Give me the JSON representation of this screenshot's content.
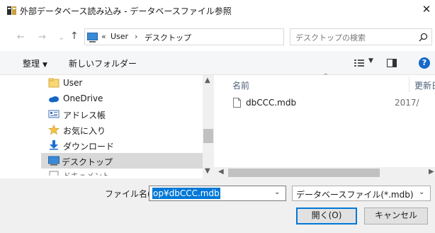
{
  "window": {
    "title": "外部データベース読み込み - データベースファイル参照",
    "close": "✕"
  },
  "address": {
    "back": "←",
    "forward": "→",
    "recent": "⌄",
    "up": "↑",
    "overflow": "«",
    "crumbs": [
      "User",
      "デスクトップ"
    ],
    "separator": "›",
    "dropdown": "⌄",
    "refresh": "↻"
  },
  "search": {
    "placeholder": "デスクトップの検索"
  },
  "toolbar": {
    "organize": "整理",
    "organize_caret": "▼",
    "new_folder": "新しいフォルダー",
    "view_caret": "▼",
    "help": "?"
  },
  "nav": {
    "items": [
      {
        "label": "User",
        "icon": "folder-icon"
      },
      {
        "label": "OneDrive",
        "icon": "onedrive-icon"
      },
      {
        "label": "アドレス帳",
        "icon": "address-book-icon"
      },
      {
        "label": "お気に入り",
        "icon": "favorites-star-icon"
      },
      {
        "label": "ダウンロード",
        "icon": "download-icon"
      },
      {
        "label": "デスクトップ",
        "icon": "desktop-icon",
        "selected": true
      },
      {
        "label": "ドキュメント",
        "icon": "documents-icon"
      }
    ]
  },
  "scroll": {
    "up": "▲",
    "down": "▼",
    "left": "◀",
    "right": "▶"
  },
  "files": {
    "sort_indicator": "^",
    "columns": [
      "名前",
      "更新日"
    ],
    "rows": [
      {
        "name": "dbCCC.mdb",
        "date": "2017/"
      }
    ]
  },
  "footer": {
    "filename_label": "ファイル名(N):",
    "filename_value": "op¥dbCCC.mdb",
    "filename_drop": "⌄",
    "filetype_value": "データベースファイル(*.mdb)",
    "filetype_drop": "⌄",
    "open_label": "開く(O)",
    "cancel_label": "キャンセル"
  },
  "colors": {
    "selection": "#0078d7",
    "nav_selected": "#d9d9d9",
    "toolbar_bg": "#f5f6f7",
    "footer_bg": "#f0f0f0",
    "help_blue": "#1769c9"
  }
}
